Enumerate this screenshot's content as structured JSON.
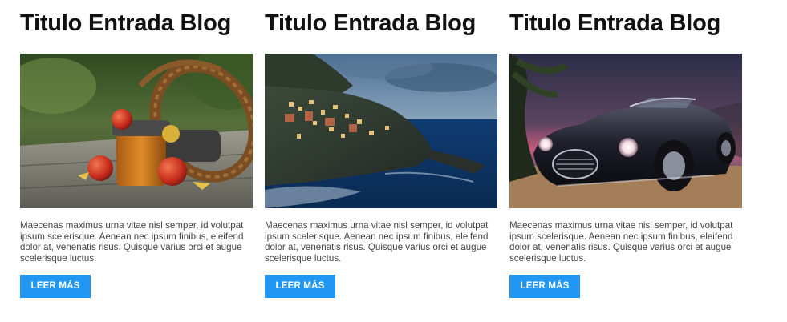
{
  "posts": [
    {
      "title": "Titulo Entrada Blog",
      "image": "photo-apples-basket-jam",
      "excerpt": "Maecenas maximus urna vitae nisl semper, id volutpat ipsum scelerisque. Aenean nec ipsum finibus, eleifend dolor at, venenatis risus. Quisque varius orci et augue scelerisque luctus.",
      "button_label": "LEER MÁS"
    },
    {
      "title": "Titulo Entrada Blog",
      "image": "photo-cliffside-village-sea",
      "excerpt": "Maecenas maximus urna vitae nisl semper, id volutpat ipsum scelerisque. Aenean nec ipsum finibus, eleifend dolor at, venenatis risus. Quisque varius orci et augue scelerisque luctus.",
      "button_label": "LEER MÁS"
    },
    {
      "title": "Titulo Entrada Blog",
      "image": "photo-classic-convertible-car",
      "excerpt": "Maecenas maximus urna vitae nisl semper, id volutpat ipsum scelerisque. Aenean nec ipsum finibus, eleifend dolor at, venenatis risus. Quisque varius orci et augue scelerisque luctus.",
      "button_label": "LEER MÁS"
    }
  ],
  "colors": {
    "button_bg": "#2196f3",
    "button_text": "#ffffff",
    "title": "#111111",
    "excerpt": "#444444"
  }
}
